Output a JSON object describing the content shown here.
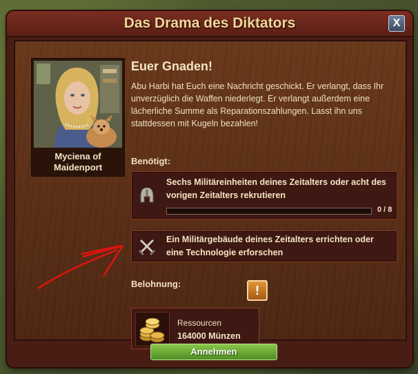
{
  "dialog": {
    "title": "Das Drama des Diktators",
    "close_label": "X"
  },
  "character": {
    "name": "Myciena of Maidenport"
  },
  "message": {
    "heading": "Euer Gnaden!",
    "body": "Abu Harbi hat Euch eine Nachricht geschickt. Er verlangt, dass Ihr unverzüglich die Waffen niederlegt. Er verlangt außerdem eine lächerliche Summe als Reparationszahlungen. Lasst ihn uns stattdessen mit Kugeln bezahlen!"
  },
  "requirements": {
    "label": "Benötigt:",
    "items": [
      {
        "icon": "helmet-icon",
        "text": "Sechs Militäreinheiten deines Zeitalters oder acht des vorigen Zeitalters rekrutieren",
        "progress_text": "0 / 8",
        "progress_fraction": 0
      },
      {
        "icon": "crossed-swords-icon",
        "text": "Ein Militärgebäude deines Zeitalters errichten oder eine Technologie erforschen"
      }
    ]
  },
  "reward": {
    "label": "Belohnung:",
    "icon": "gold-coins-icon",
    "type": "Ressourcen",
    "value": "164000 Münzen",
    "alert_label": "!"
  },
  "actions": {
    "accept_label": "Annehmen"
  },
  "colors": {
    "title_text": "#f2d79b",
    "accept_button": "#6aab36",
    "annotation_arrow": "#e0140e"
  }
}
